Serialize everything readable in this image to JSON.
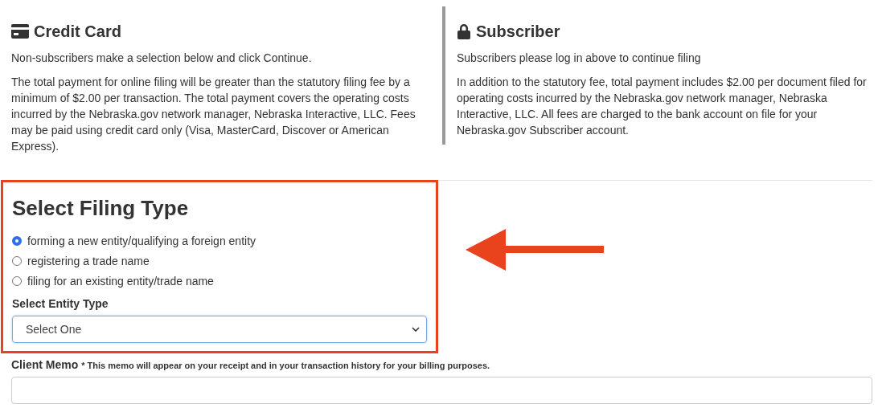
{
  "credit_card": {
    "title": "Credit Card",
    "intro": "Non-subscribers make a selection below and click Continue.",
    "details": "The total payment for online filing will be greater than the statutory filing fee by a minimum of $2.00 per transaction. The total payment covers the operating costs incurred by the Nebraska.gov network manager, Nebraska Interactive, LLC. Fees may be paid using credit card only (Visa, MasterCard, Discover or American Express)."
  },
  "subscriber": {
    "title": "Subscriber",
    "intro": "Subscribers please log in above to continue filing",
    "details": "In addition to the statutory fee, total payment includes $2.00 per document filed for operating costs incurred by the Nebraska.gov network manager, Nebraska Interactive, LLC. All fees are charged to the bank account on file for your Nebraska.gov Subscriber account."
  },
  "filing_type": {
    "title": "Select Filing Type",
    "options": [
      {
        "label": "forming a new entity/qualifying a foreign entity",
        "selected": true
      },
      {
        "label": "registering a trade name",
        "selected": false
      },
      {
        "label": "filing for an existing entity/trade name",
        "selected": false
      }
    ],
    "entity_label": "Select Entity Type",
    "entity_select": {
      "value": "Select One"
    }
  },
  "client_memo": {
    "label": "Client Memo",
    "note": "* This memo will appear on your receipt and in your transaction history for your billing purposes."
  }
}
